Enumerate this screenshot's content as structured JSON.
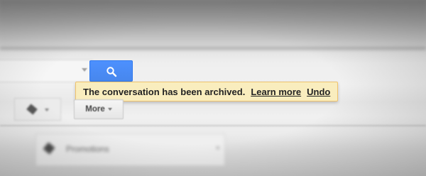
{
  "search": {
    "button_icon": "search-icon"
  },
  "notification": {
    "message": "The conversation has been archived.",
    "learn_more": "Learn more",
    "undo": "Undo"
  },
  "toolbar": {
    "labels_icon": "label-icon",
    "more_label": "More"
  },
  "tabs": {
    "promotions_label": "Promotions",
    "promotions_icon": "label-icon"
  },
  "colors": {
    "search_button": "#4d90fe",
    "notice_background": "#f9edbe",
    "notice_border": "#f0c36d"
  }
}
